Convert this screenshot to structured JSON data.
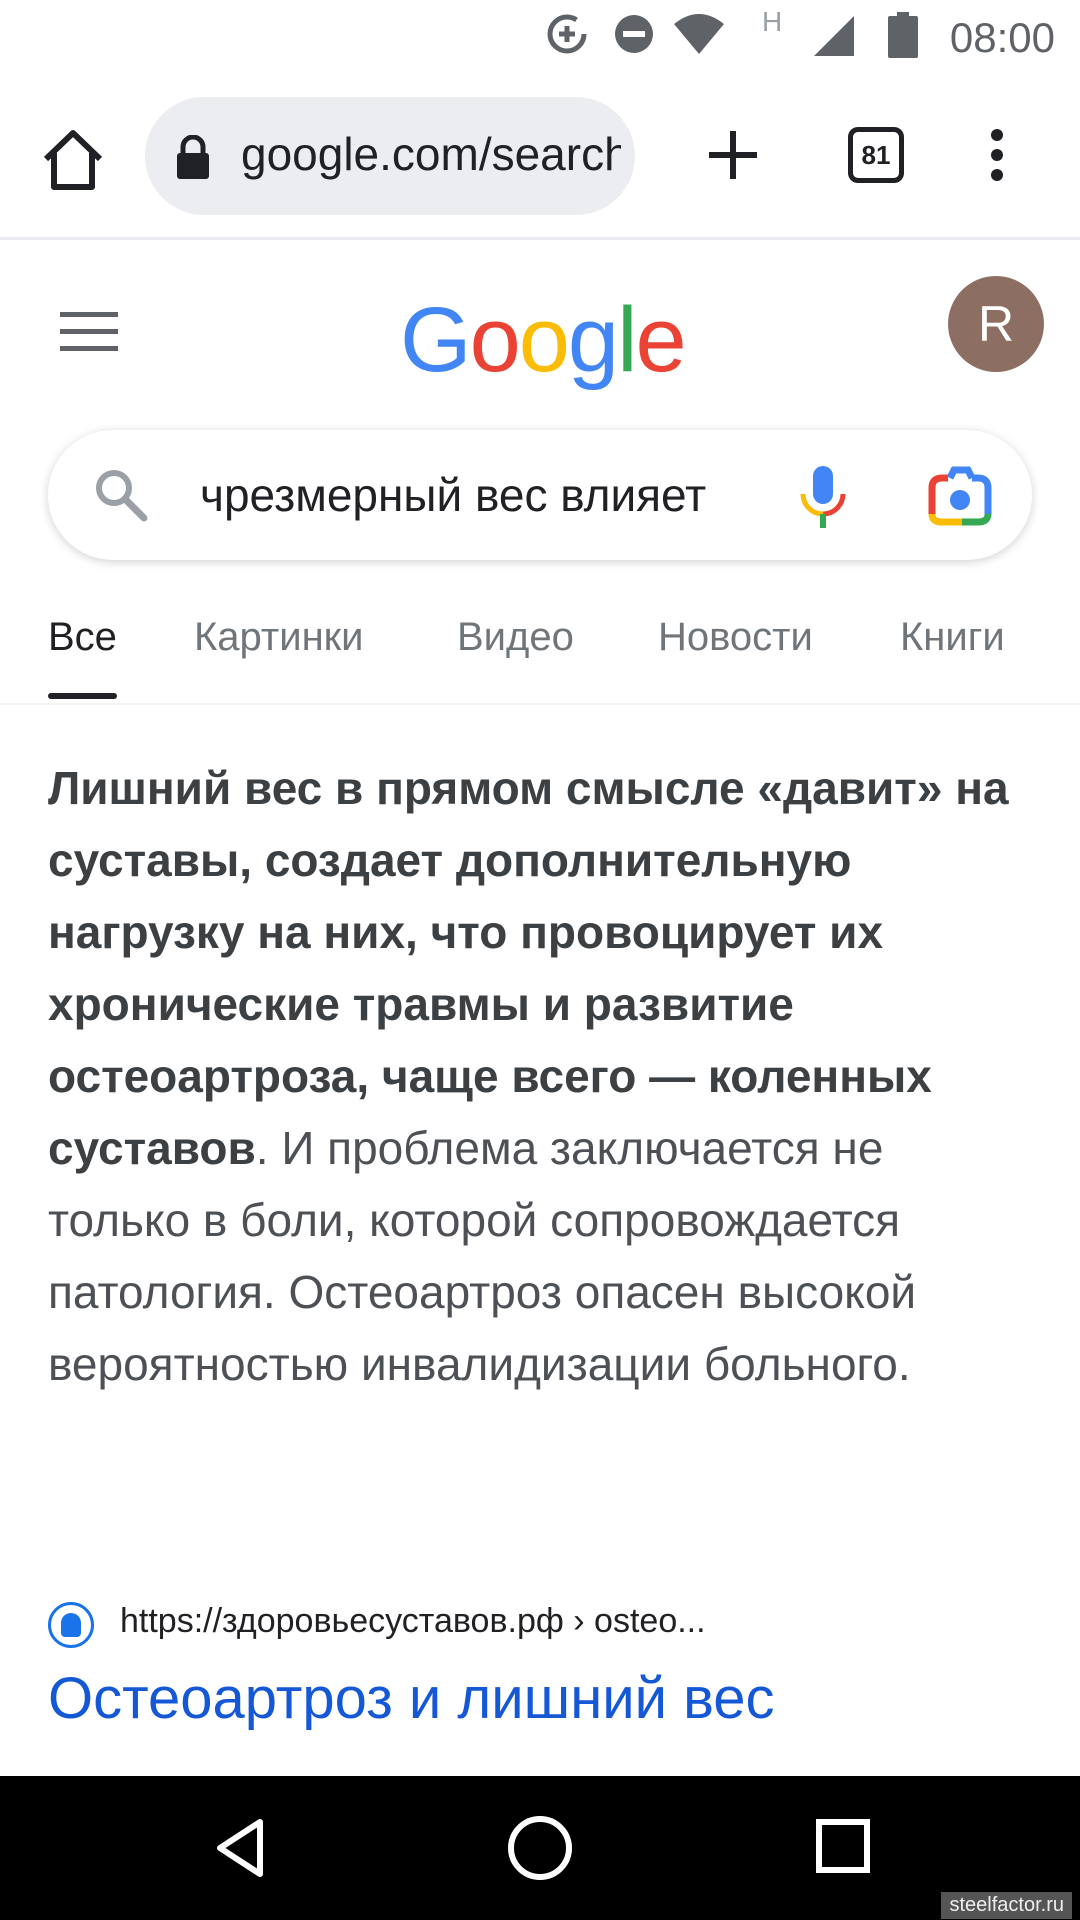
{
  "status_bar": {
    "time": "08:00",
    "icons": [
      "data-saver-icon",
      "do-not-disturb-icon",
      "wifi-icon",
      "h-network-icon",
      "cell-signal-icon",
      "battery-icon"
    ],
    "network_label": "H"
  },
  "browser": {
    "url": "google.com/search",
    "tab_count": "81",
    "icons": [
      "home-icon",
      "lock-icon",
      "plus-icon",
      "tab-switcher-icon",
      "more-vert-icon"
    ]
  },
  "google": {
    "logo_letters": [
      "G",
      "o",
      "o",
      "g",
      "l",
      "e"
    ],
    "logo_colors": [
      "#4285F4",
      "#EA4335",
      "#FBBC05",
      "#4285F4",
      "#34A853",
      "#EA4335"
    ],
    "avatar_letter": "R",
    "avatar_color": "#8d6e63"
  },
  "search": {
    "query": "чрезмерный вес влияет",
    "icons": [
      "search-icon",
      "mic-icon",
      "google-lens-icon"
    ]
  },
  "tabs": [
    {
      "label": "Все",
      "active": true
    },
    {
      "label": "Картинки",
      "active": false
    },
    {
      "label": "Видео",
      "active": false
    },
    {
      "label": "Новости",
      "active": false
    },
    {
      "label": "Книги",
      "active": false
    }
  ],
  "snippet": {
    "bold": "Лишний вес в прямом смысле «давит» на суставы, создает дополнительную нагрузку на них, что провоцирует их хронические травмы и развитие остеоартроза, чаще всего — коленных суставов",
    "normal": ". И проблема заключается не только в боли, которой сопровождается патология. Остеоартроз опасен высокой вероятностью инвалидизации больного."
  },
  "result": {
    "source_url": "https://здоровьесуставов.рф › osteo...",
    "title": "Остеоартроз и лишний вес"
  },
  "nav_bar": {
    "icons": [
      "back-icon",
      "home-circle-icon",
      "recents-icon"
    ]
  },
  "watermark": "steelfactor.ru"
}
